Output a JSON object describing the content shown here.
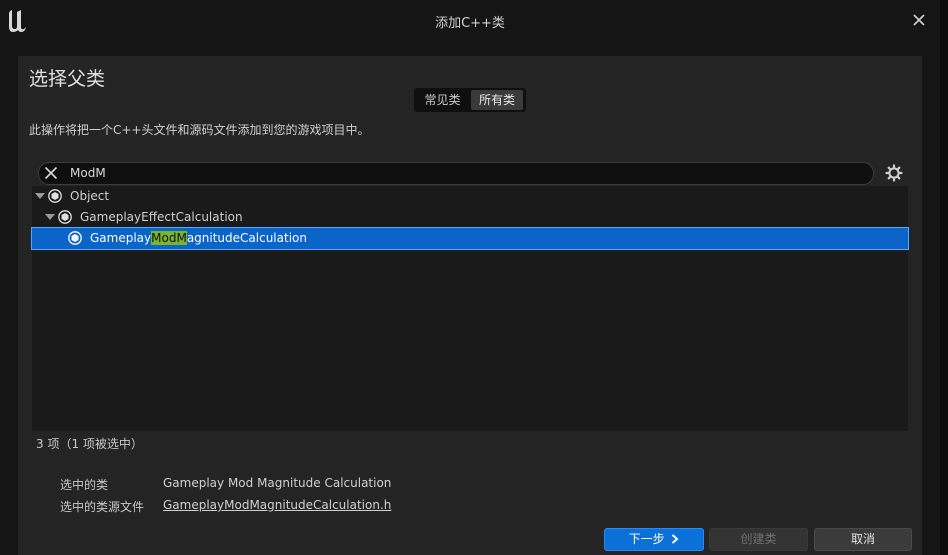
{
  "window": {
    "title": "添加C++类",
    "logo": "unreal-engine-logo",
    "close_icon": "close-icon"
  },
  "heading": "选择父类",
  "class_filter": {
    "options": [
      "常见类",
      "所有类"
    ],
    "selected": "所有类"
  },
  "description": "此操作将把一个C++头文件和源码文件添加到您的游戏项目中。",
  "search": {
    "value": "ModM",
    "placeholder": ""
  },
  "tree": {
    "items": [
      {
        "label": "Object",
        "depth": 0,
        "expanded": true,
        "selected": false
      },
      {
        "label": "GameplayEffectCalculation",
        "depth": 1,
        "expanded": true,
        "selected": false
      },
      {
        "label": "GameplayModMagnitudeCalculation",
        "label_pre": "Gameplay",
        "label_match": "ModM",
        "label_post": "agnitudeCalculation",
        "depth": 2,
        "expanded": false,
        "selected": true
      }
    ]
  },
  "item_count": "3 项（1 项被选中）",
  "info": {
    "selected_class_label": "选中的类",
    "selected_class_value": "Gameplay Mod Magnitude Calculation",
    "source_file_label": "选中的类源文件",
    "source_file_value": "GameplayModMagnitudeCalculation.h"
  },
  "buttons": {
    "next": "下一步",
    "create": "创建类",
    "cancel": "取消"
  },
  "colors": {
    "background": "#151515",
    "panel": "#242424",
    "tree_bg": "#1a1a1a",
    "selection": "#0b64c8",
    "search_match": "#7ab52a",
    "primary_button": "#0b70d8"
  }
}
